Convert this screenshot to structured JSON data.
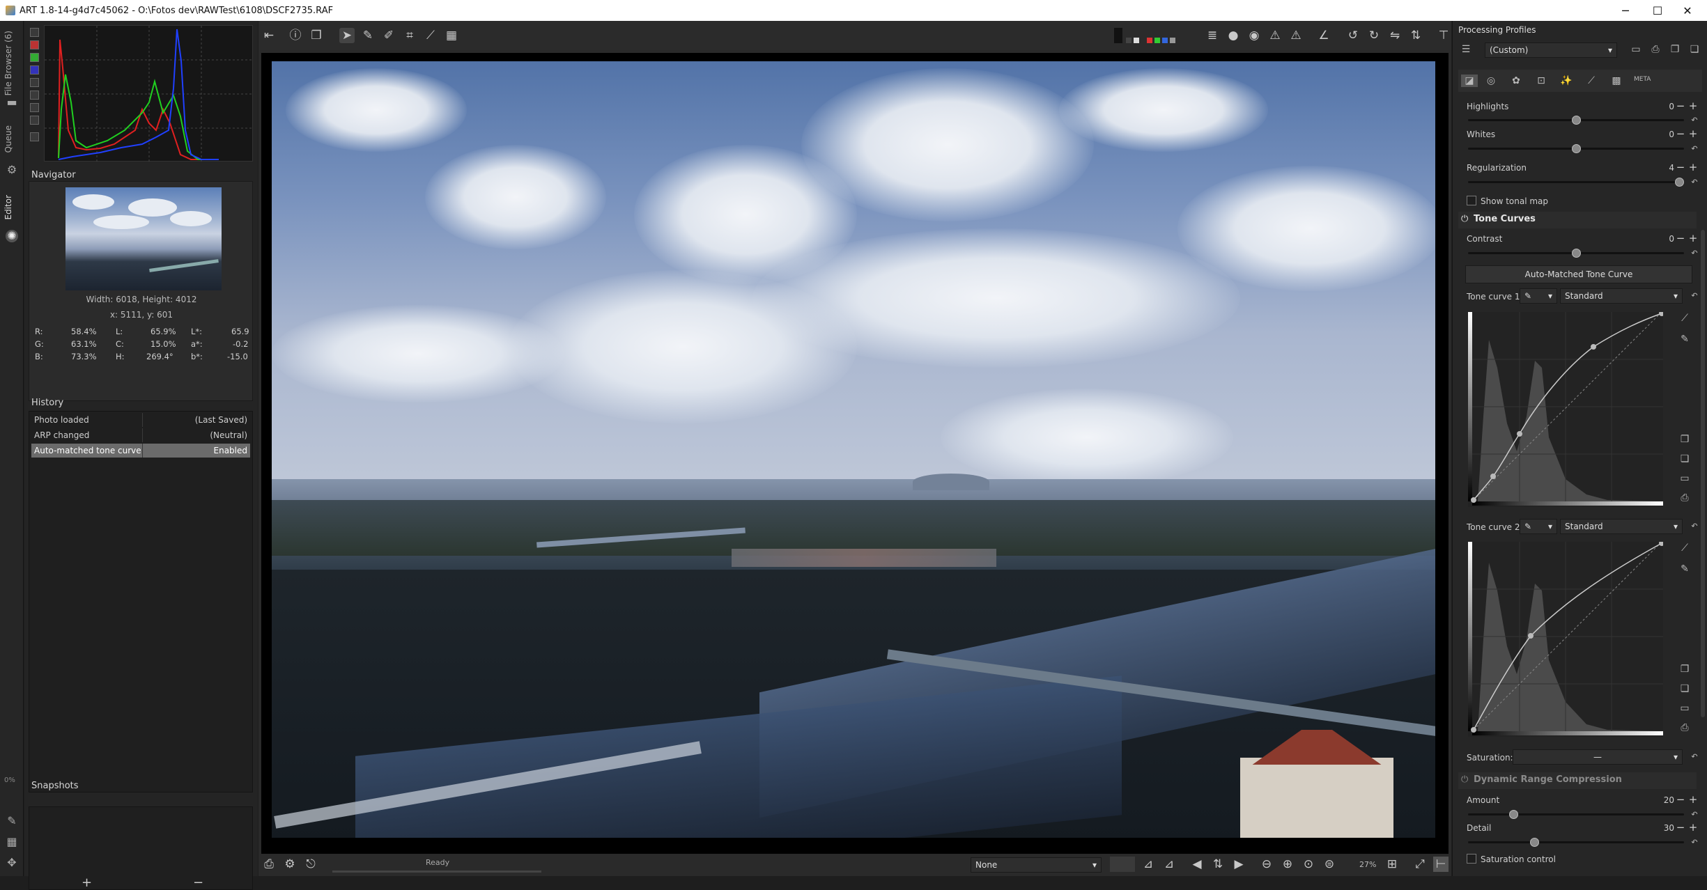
{
  "window": {
    "title": "ART 1.8-14-g4d7c45062 - O:\\Fotos dev\\RAWTest\\6108\\DSCF2735.RAF",
    "minimize_glyph": "─",
    "maximize_glyph": "☐",
    "close_glyph": "✕"
  },
  "vertical_tabs": {
    "file_browser": "File Browser (6)",
    "queue": "Queue",
    "editor": "Editor",
    "zoom_percent": "0%"
  },
  "navigator": {
    "title": "Navigator",
    "dimensions": "Width: 6018, Height: 4012",
    "coords": "x: 5111, y: 601",
    "readouts": [
      {
        "label": "R:",
        "value": "58.4%",
        "label2": "L:",
        "value2": "65.9%",
        "label3": "L*:",
        "value3": "65.9"
      },
      {
        "label": "G:",
        "value": "63.1%",
        "label2": "C:",
        "value2": "15.0%",
        "label3": "a*:",
        "value3": "-0.2"
      },
      {
        "label": "B:",
        "value": "73.3%",
        "label2": "H:",
        "value2": "269.4°",
        "label3": "b*:",
        "value3": "-15.0"
      }
    ]
  },
  "history": {
    "title": "History",
    "items": [
      {
        "name": "Photo loaded",
        "state": "(Last Saved)"
      },
      {
        "name": "ARP changed",
        "state": "(Neutral)"
      },
      {
        "name": "Auto-matched tone curve",
        "state": "Enabled",
        "selected": true
      }
    ]
  },
  "snapshots": {
    "title": "Snapshots",
    "add_glyph": "+",
    "remove_glyph": "−"
  },
  "bottom_bar": {
    "status": "Ready",
    "profile_select": "None",
    "zoom_level": "27%"
  },
  "right_panel": {
    "processing_profiles_title": "Processing Profiles",
    "profile_value": "(Custom)",
    "highlights": {
      "label": "Highlights",
      "value": "0",
      "level": 0.5
    },
    "whites": {
      "label": "Whites",
      "value": "0",
      "level": 0.5
    },
    "regularization": {
      "label": "Regularization",
      "value": "4",
      "level": 1.0
    },
    "show_tonal_map": "Show tonal map",
    "tone_curves": {
      "title": "Tone Curves",
      "contrast_label": "Contrast",
      "contrast_value": "0",
      "contrast_level": 0.5,
      "auto_matched_button": "Auto-Matched Tone Curve",
      "curve1_label": "Tone curve 1:",
      "curve1_mode": "Standard",
      "curve2_label": "Tone curve 2:",
      "curve2_mode": "Standard",
      "saturation_label": "Saturation:",
      "saturation_value": "—"
    },
    "drc": {
      "title": "Dynamic Range Compression",
      "amount_label": "Amount",
      "amount_value": "20",
      "amount_level": 0.2,
      "detail_label": "Detail",
      "detail_value": "30",
      "detail_level": 0.3,
      "saturation_control": "Saturation control"
    },
    "meta_tab": "META"
  },
  "colors": {
    "accent_selection": "#6b6b6b",
    "histogram_red": "#e02020",
    "histogram_green": "#20d020",
    "histogram_blue": "#2040ff"
  }
}
